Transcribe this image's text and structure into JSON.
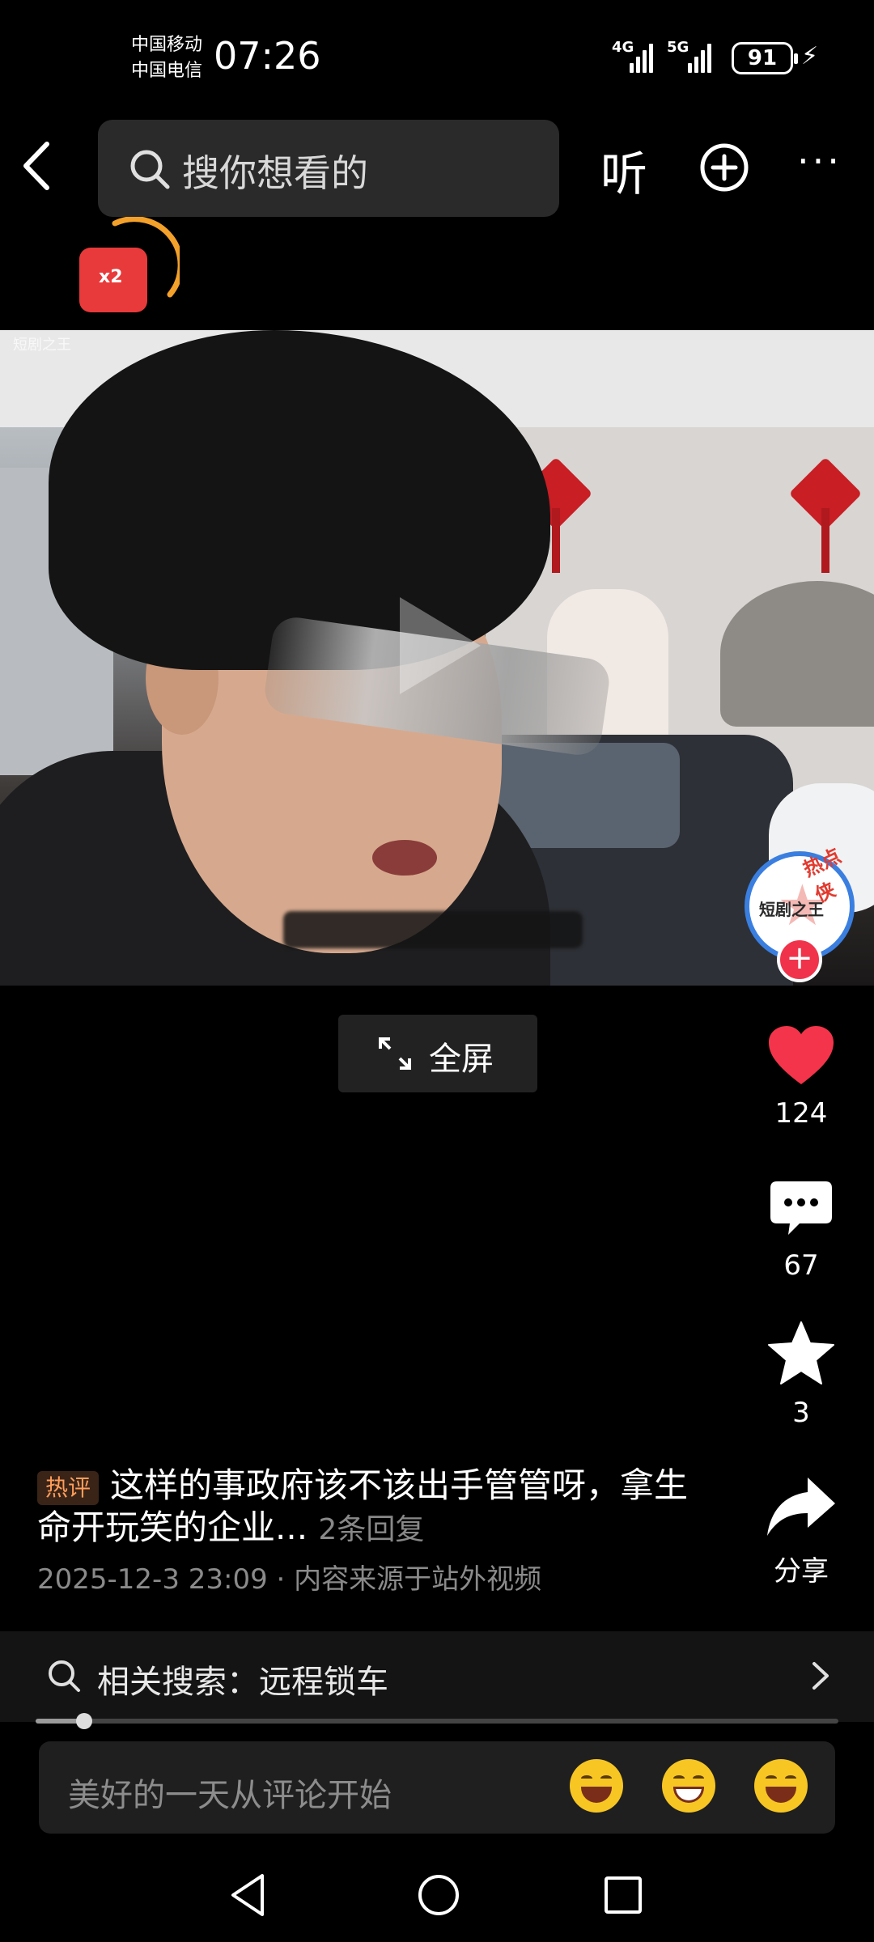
{
  "status_bar": {
    "carrier_1": "中国移动",
    "carrier_2": "中国电信",
    "time": "07:26",
    "signal_1": "4G",
    "signal_2": "5G",
    "battery": "91"
  },
  "header": {
    "search_placeholder": "搜你想看的",
    "listen_label": "听",
    "more_label": "···"
  },
  "red_packet": {
    "label": "x2"
  },
  "video": {
    "watermark": "短剧之王",
    "avatar_badge": "热点侠",
    "avatar_name": "短剧之王"
  },
  "fullscreen": {
    "label": "全屏"
  },
  "actions": {
    "like_count": "124",
    "comment_count": "67",
    "favorite_count": "3",
    "share_label": "分享"
  },
  "hot_comment": {
    "badge": "热评",
    "text": "这样的事政府该不该出手管管呀，拿生命开玩笑的企业...",
    "replies": "2条回复",
    "meta": "2025-12-3 23:09 · 内容来源于站外视频"
  },
  "related_search": {
    "label": "相关搜索：远程锁车"
  },
  "progress": {
    "value": 0.06
  },
  "comment_input": {
    "placeholder": "美好的一天从评论开始"
  },
  "colors": {
    "like": "#f3344a",
    "accent": "#3a7fe0",
    "hot_badge": "#ff9d59"
  }
}
